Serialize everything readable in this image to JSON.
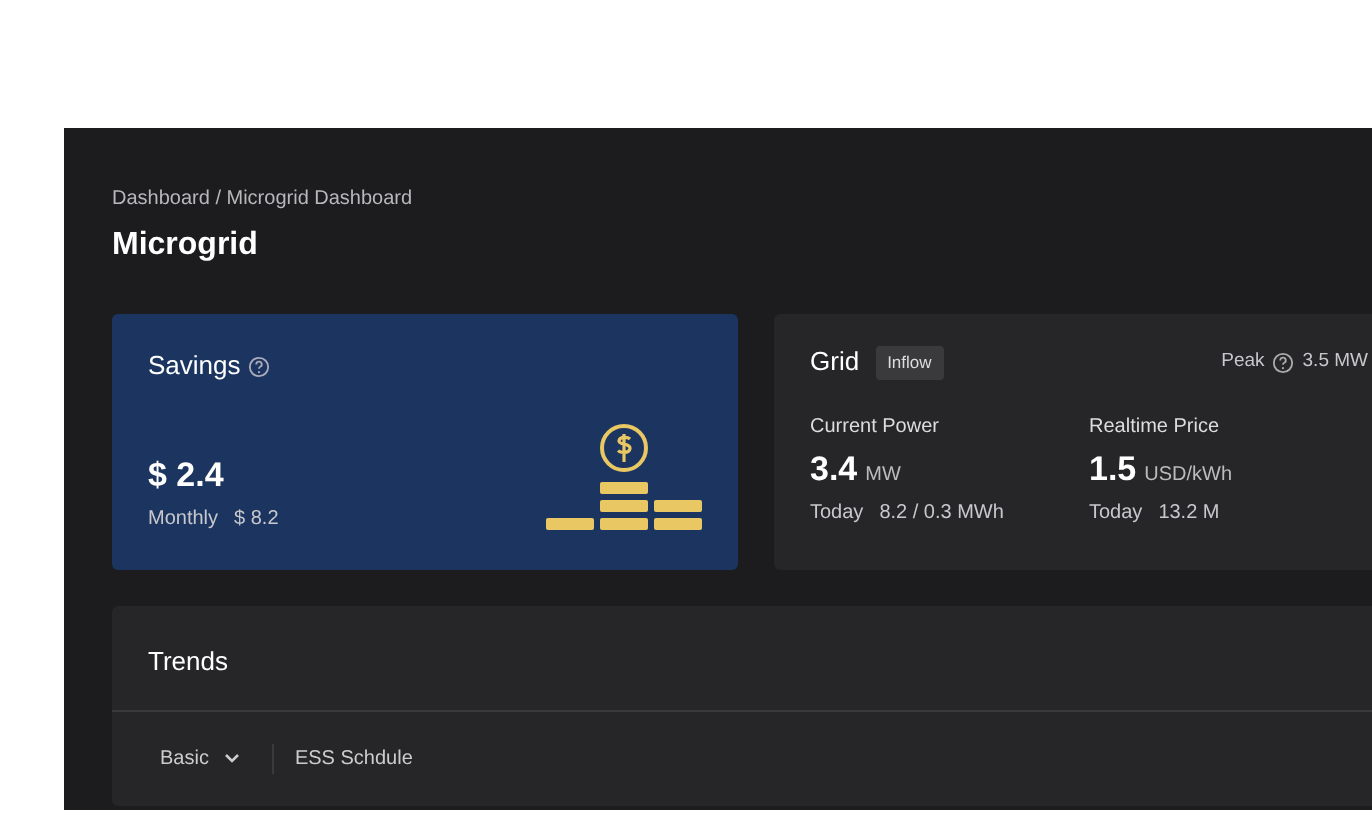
{
  "breadcrumb": "Dashboard / Microgrid  Dashboard",
  "title": "Microgrid",
  "savings": {
    "title": "Savings",
    "value": "$ 2.4",
    "sub_label": "Monthly",
    "sub_value": "$ 8.2"
  },
  "grid": {
    "title": "Grid",
    "tag": "Inflow",
    "peak_label": "Peak",
    "peak_value": "3.5 MW",
    "metrics": [
      {
        "label": "Current Power",
        "value": "3.4",
        "unit": "MW",
        "sub_label": "Today",
        "sub_value": "8.2 / 0.3 MWh"
      },
      {
        "label": "Realtime Price",
        "value": "1.5",
        "unit": "USD/kWh",
        "sub_label": "Today",
        "sub_value": "13.2 M"
      }
    ]
  },
  "trends": {
    "title": "Trends",
    "dropdown": "Basic",
    "tab": "ESS Schdule"
  }
}
